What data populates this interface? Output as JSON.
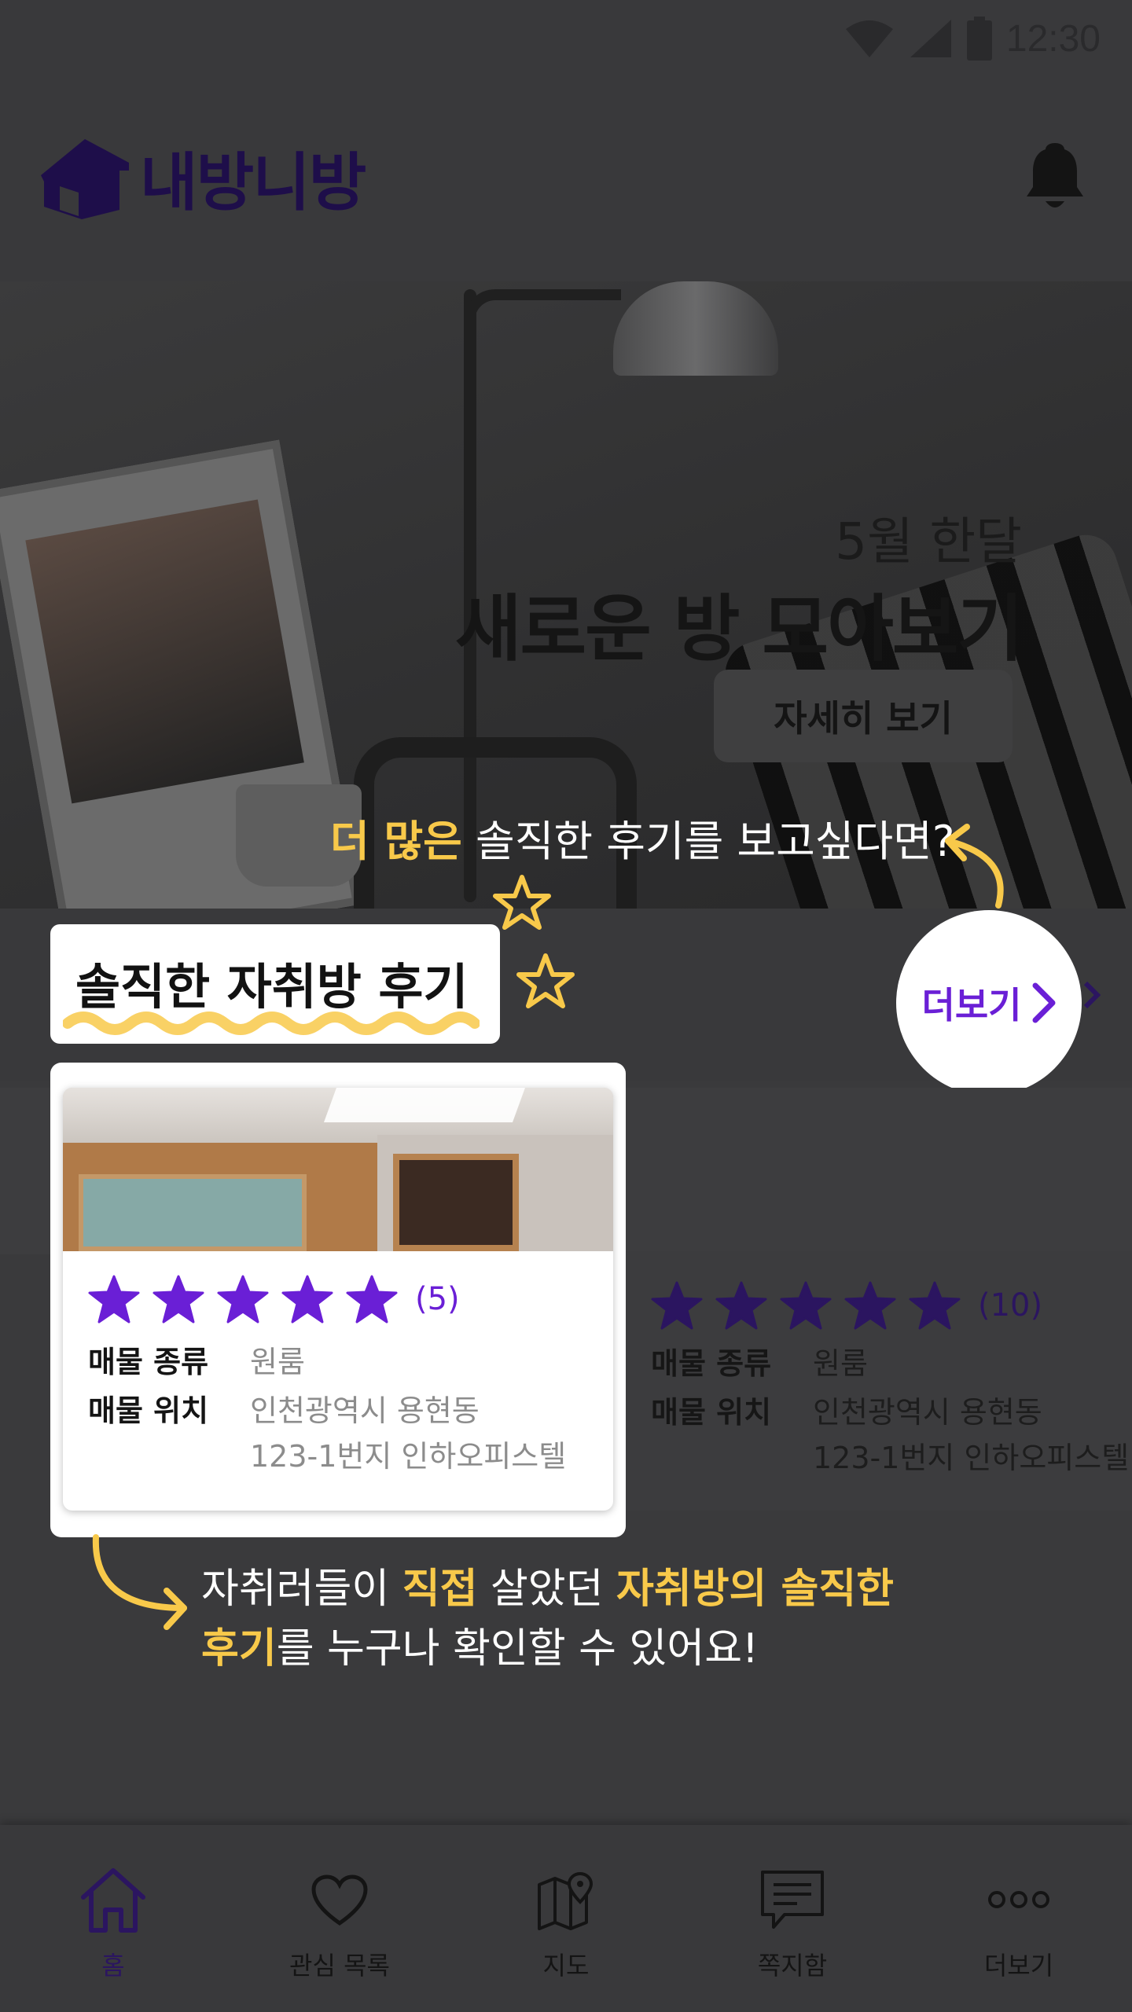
{
  "status_bar": {
    "time": "12:30"
  },
  "header": {
    "app_name": "내방니방"
  },
  "banner": {
    "subtitle": "5월 한달",
    "title": "새로운 방 모아보기",
    "button_label": "자세히 보기"
  },
  "callout_top": {
    "highlight": "더 많은",
    "text": " 솔직한 후기를 보고싶다면?"
  },
  "section": {
    "title": "솔직한 자취방 후기",
    "more_label": "더보기"
  },
  "reviews": [
    {
      "rating": 5,
      "count": "(5)",
      "type_label": "매물 종류",
      "type_value": "원룸",
      "location_label": "매물 위치",
      "location_line1": "인천광역시 용현동",
      "location_line2": "123-1번지 인하오피스텔"
    },
    {
      "rating": 5,
      "count": "(10)",
      "type_label": "매물 종류",
      "type_value": "원룸",
      "location_label": "매물 위치",
      "location_line1": "인천광역시 용현동",
      "location_line2": "123-1번지 인하오피스텔"
    }
  ],
  "callout_bottom": {
    "t1": "자취러들이 ",
    "h1": "직접",
    "t2": " 살았던 ",
    "h2": "자취방의 솔직한",
    "h3": "후기",
    "t3": "를 누구나 확인할 수 있어요!"
  },
  "bottom_nav": {
    "items": [
      {
        "label": "홈",
        "icon": "home-icon",
        "active": true
      },
      {
        "label": "관심 목록",
        "icon": "heart-icon"
      },
      {
        "label": "지도",
        "icon": "map-icon"
      },
      {
        "label": "쪽지함",
        "icon": "message-icon"
      },
      {
        "label": "더보기",
        "icon": "more-dots-icon"
      }
    ]
  },
  "colors": {
    "accent_purple": "#6a1fd6",
    "highlight_yellow": "#f8c94a",
    "overlay_dark": "#3a3a3c"
  }
}
